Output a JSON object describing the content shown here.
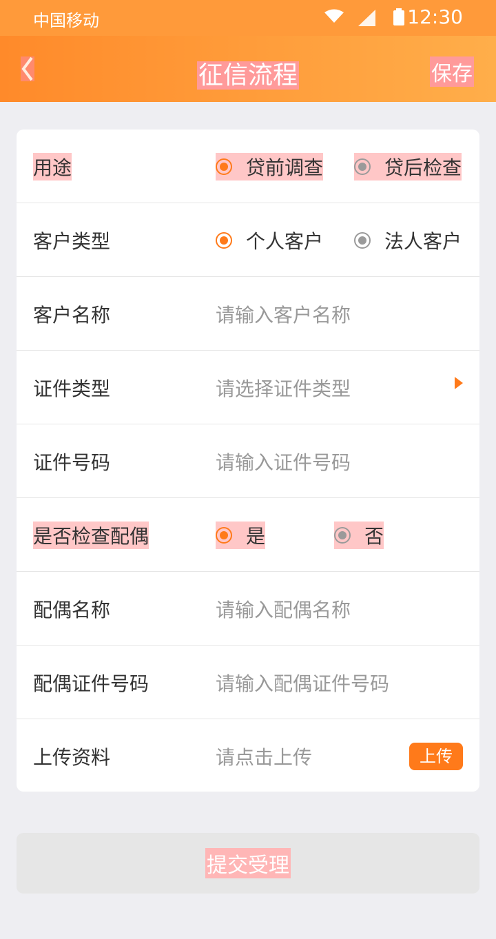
{
  "statusbar": {
    "carrier": "中国移动",
    "time": "12:30"
  },
  "nav": {
    "title": "征信流程",
    "save": "保存"
  },
  "rows": [
    {
      "label": "用途",
      "options": [
        "贷前调查",
        "贷后检查"
      ],
      "selected": 0
    },
    {
      "label": "客户类型",
      "options": [
        "个人客户",
        "法人客户"
      ],
      "selected": 0
    },
    {
      "label": "客户名称",
      "placeholder": "请输入客户名称"
    },
    {
      "label": "证件类型",
      "placeholder": "请选择证件类型"
    },
    {
      "label": "证件号码",
      "placeholder": "请输入证件号码"
    },
    {
      "label": "是否检查配偶",
      "options": [
        "是",
        "否"
      ],
      "selected": 0
    },
    {
      "label": "配偶名称",
      "placeholder": "请输入配偶名称"
    },
    {
      "label": "配偶证件号码",
      "placeholder": "请输入配偶证件号码"
    },
    {
      "label": "上传资料",
      "placeholder": "请点击上传",
      "button": "上传"
    }
  ],
  "submit": "提交受理"
}
